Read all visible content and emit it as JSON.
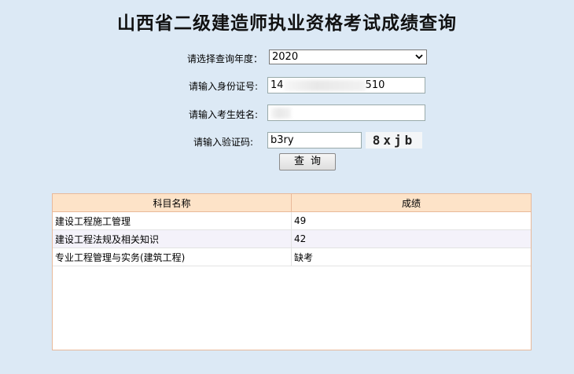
{
  "page": {
    "title": "山西省二级建造师执业资格考试成绩查询"
  },
  "form": {
    "year_label": "请选择查询年度：",
    "year_value": "2020",
    "id_label": "请输入身份证号:",
    "id_prefix": "14",
    "id_suffix": "510",
    "name_label": "请输入考生姓名:",
    "captcha_label": "请输入验证码:",
    "captcha_value": "b3ry",
    "captcha_image_text": "8xjb",
    "query_button": "查询"
  },
  "results": {
    "headers": [
      "科目名称",
      "成绩"
    ],
    "rows": [
      {
        "subject": "建设工程施工管理",
        "score": "49"
      },
      {
        "subject": "建设工程法规及相关知识",
        "score": "42"
      },
      {
        "subject": "专业工程管理与实务(建筑工程)",
        "score": "缺考"
      }
    ]
  }
}
